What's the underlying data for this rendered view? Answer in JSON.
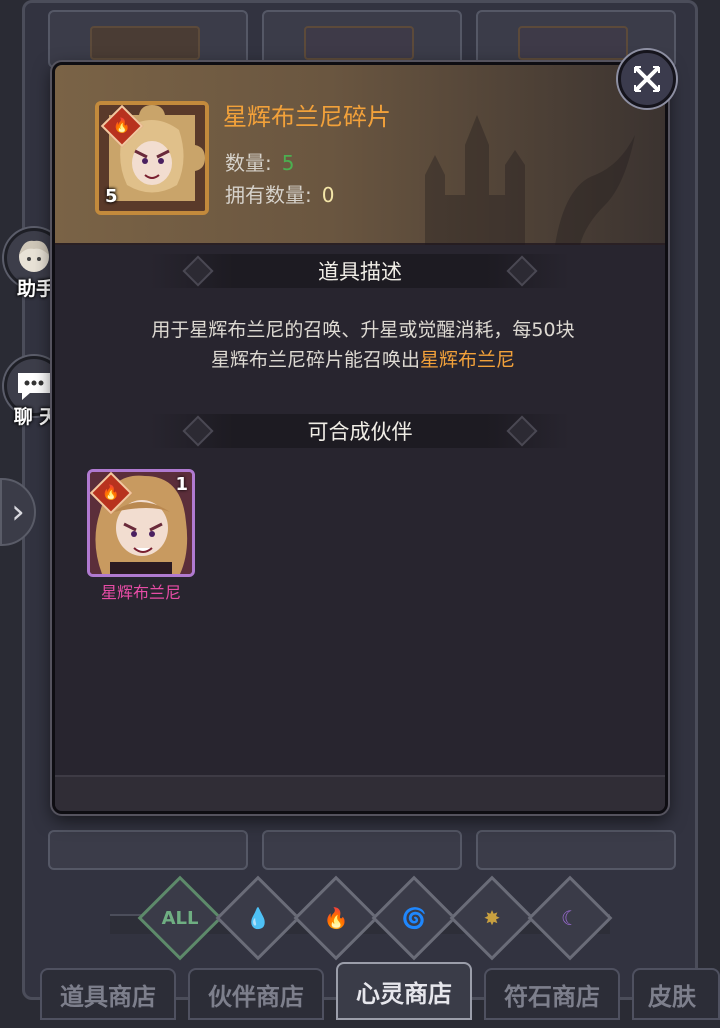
{
  "modal": {
    "item_name": "星辉布兰尼碎片",
    "item_count_badge": "5",
    "quantity_label": "数量:",
    "quantity_value": "5",
    "owned_label": "拥有数量:",
    "owned_value": "0",
    "section_description_title": "道具描述",
    "description_line1": "用于星辉布兰尼的召唤、升星或觉醒消耗，每50块",
    "description_line2_prefix": "星辉布兰尼碎片能召唤出",
    "description_line2_highlight": "星辉布兰尼",
    "section_partner_title": "可合成伙伴",
    "partner": {
      "name": "星辉布兰尼",
      "level": "1",
      "element": "fire"
    }
  },
  "side": {
    "assistant_label": "助手",
    "chat_label": "聊 天"
  },
  "element_filters": [
    "ALL",
    "water",
    "fire",
    "wind",
    "light",
    "dark"
  ],
  "tabs": [
    {
      "label": "道具商店",
      "active": false
    },
    {
      "label": "伙伴商店",
      "active": false
    },
    {
      "label": "心灵商店",
      "active": true
    },
    {
      "label": "符石商店",
      "active": false
    },
    {
      "label": "皮肤",
      "active": false
    }
  ],
  "colors": {
    "item_name": "#f2a13a",
    "quantity": "#4caf50",
    "owned": "#f4e6a8",
    "partner_name": "#e74ca6",
    "highlight": "#f2a13a"
  }
}
